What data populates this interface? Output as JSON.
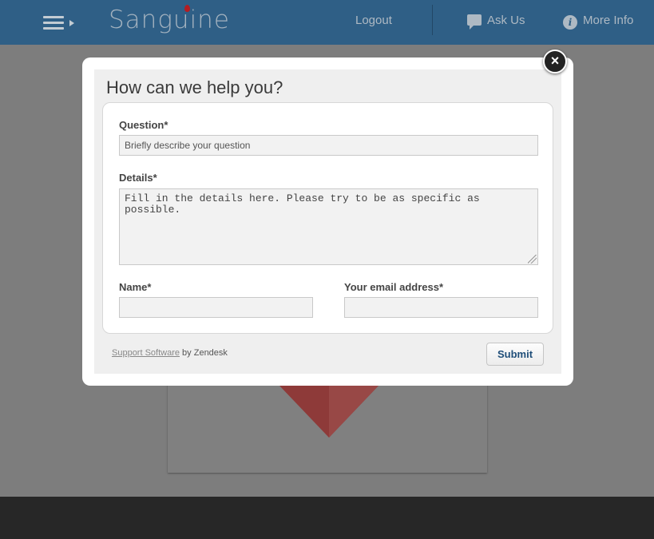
{
  "header": {
    "logo_text": "Sanguine",
    "logout_label": "Logout",
    "ask_us_label": "Ask Us",
    "more_info_label": "More Info",
    "info_icon_glyph": "i",
    "icons": [
      "menu-icon",
      "chat-bubble-icon",
      "info-icon"
    ]
  },
  "modal": {
    "close_glyph": "×",
    "title": "How can we help you?",
    "question_label": "Question*",
    "question_value": "Briefly describe your question",
    "details_label": "Details*",
    "details_value": "Fill in the details here. Please try to be as specific as possible.",
    "name_label": "Name*",
    "name_value": "",
    "email_label": "Your email address*",
    "email_value": "",
    "powered_link": "Support Software",
    "powered_suffix": " by Zendesk",
    "submit_label": "Submit"
  },
  "colors": {
    "header_bg": "#2f5f86",
    "logo_drop": "#b31d22",
    "overlay_bg": "#7d7d7d",
    "footer_bg": "#272727",
    "submit_text": "#1f4e79"
  }
}
